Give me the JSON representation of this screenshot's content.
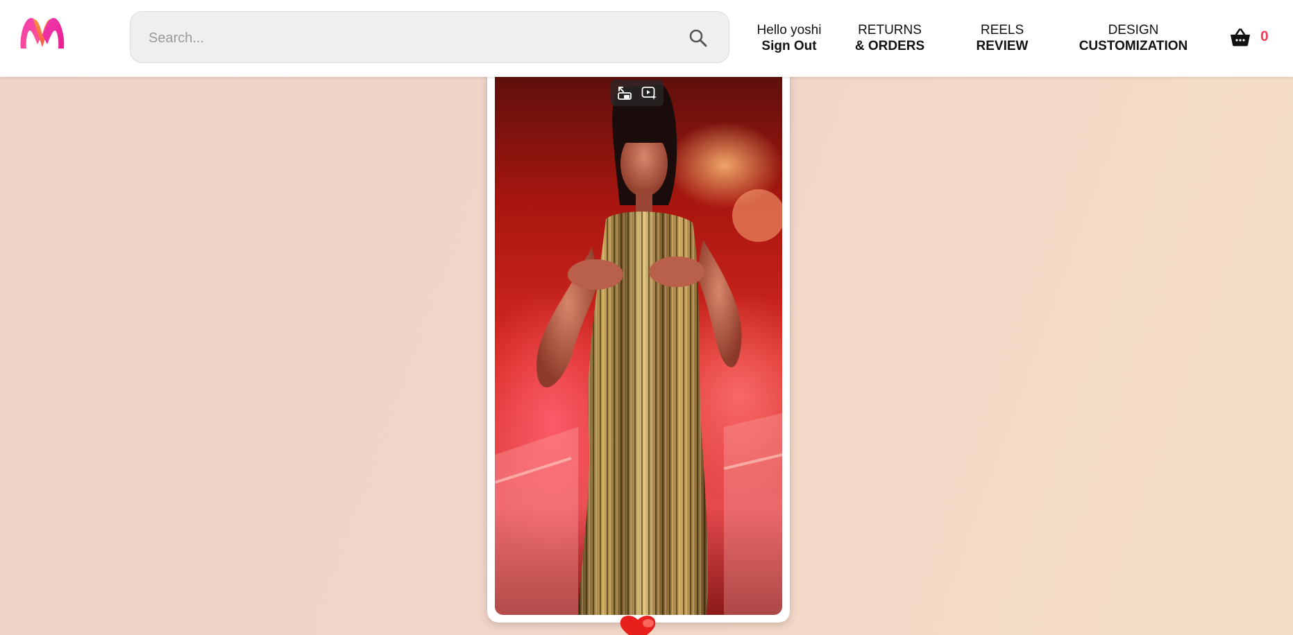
{
  "header": {
    "search": {
      "placeholder": "Search..."
    },
    "account": {
      "greeting": "Hello yoshi",
      "action": "Sign Out"
    },
    "returns": {
      "line1": "RETURNS",
      "line2": "& ORDERS"
    },
    "reels": {
      "line1": "REELS",
      "line2": "REVIEW"
    },
    "design": {
      "line1": "DESIGN",
      "line2": "CUSTOMIZATION"
    },
    "cart": {
      "count": "0",
      "count_color": "#ef3e5c"
    },
    "logo": {
      "icon": "myntra-m-logo",
      "colors": [
        "#f13ab1",
        "#fd913c",
        "#ff3f6c"
      ]
    }
  },
  "reel": {
    "video_controls": {
      "popout_icon": "picture-in-picture-icon",
      "enhance_icon": "video-enhance-icon"
    },
    "like_icon": "heart-icon",
    "like_color": "#e8201c"
  },
  "colors": {
    "background_left": "#efd1c8",
    "background_right": "#f4dfc6"
  }
}
